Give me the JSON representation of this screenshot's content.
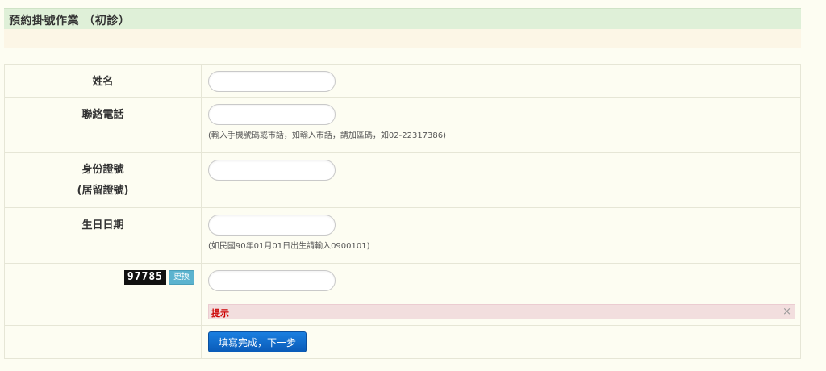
{
  "header": {
    "title": "預約掛號作業 （初診）"
  },
  "form": {
    "name": {
      "label": "姓名",
      "value": ""
    },
    "phone": {
      "label": "聯絡電話",
      "value": "",
      "hint": "(輸入手機號碼或市話，如輸入市話，請加區碼，如02-22317386)"
    },
    "id_number": {
      "label_line1": "身份證號",
      "label_line2": "(居留證號)",
      "value": ""
    },
    "birthday": {
      "label": "生日日期",
      "value": "",
      "hint": "(如民國90年01月01日出生請輸入0900101)"
    },
    "captcha": {
      "code": "97785",
      "refresh_label": "更換",
      "value": ""
    },
    "alert": {
      "text": "提示",
      "close_glyph": "×"
    },
    "submit_label": "填寫完成，下一步"
  },
  "colors": {
    "title_bar": "#dff0d8",
    "sub_bar": "#fcf6e6",
    "background": "#fdfdf2",
    "alert_bg": "#f2dede",
    "alert_text": "#cc0000",
    "submit_button": "#0a6fd0",
    "refresh_button": "#5bb3cf"
  }
}
